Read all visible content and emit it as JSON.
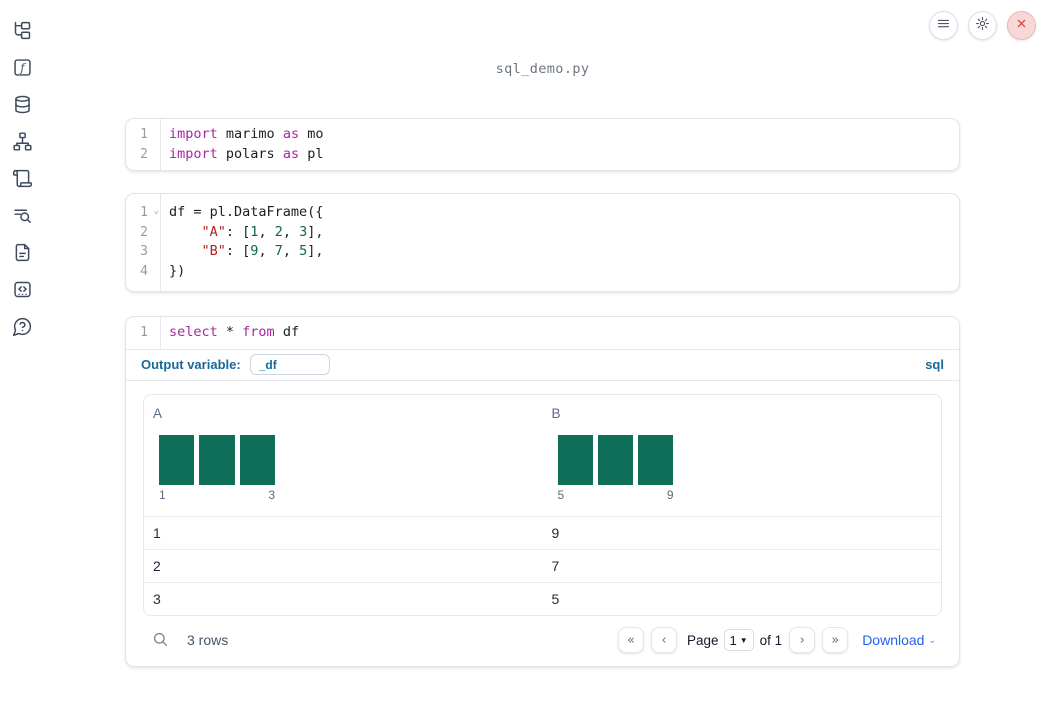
{
  "window": {
    "title": "sql_demo.py"
  },
  "sidebar": {
    "icons": [
      "file-explorer",
      "variables",
      "data-sources",
      "dependencies",
      "logs",
      "search-logs",
      "documentation",
      "snippets",
      "help"
    ]
  },
  "topbar": {
    "menu_icon": "hamburger-menu",
    "settings_icon": "gear",
    "close_icon": "x"
  },
  "cells": [
    {
      "lines": [
        {
          "num": "1",
          "tokens": [
            [
              "kw",
              "import"
            ],
            [
              "pl",
              " marimo "
            ],
            [
              "kw",
              "as"
            ],
            [
              "pl",
              " mo"
            ]
          ]
        },
        {
          "num": "2",
          "tokens": [
            [
              "kw",
              "import"
            ],
            [
              "pl",
              " polars "
            ],
            [
              "kw",
              "as"
            ],
            [
              "pl",
              " pl"
            ]
          ]
        }
      ]
    },
    {
      "lines": [
        {
          "num": "1",
          "fold": "⌄",
          "tokens": [
            [
              "pl",
              "df = pl.DataFrame({"
            ]
          ]
        },
        {
          "num": "2",
          "tokens": [
            [
              "pl",
              "    "
            ],
            [
              "str",
              "\"A\""
            ],
            [
              "pl",
              ": ["
            ],
            [
              "no",
              "1"
            ],
            [
              "pl",
              ", "
            ],
            [
              "no",
              "2"
            ],
            [
              "pl",
              ", "
            ],
            [
              "no",
              "3"
            ],
            [
              "pl",
              "],"
            ]
          ]
        },
        {
          "num": "3",
          "tokens": [
            [
              "pl",
              "    "
            ],
            [
              "str",
              "\"B\""
            ],
            [
              "pl",
              ": ["
            ],
            [
              "no",
              "9"
            ],
            [
              "pl",
              ", "
            ],
            [
              "no",
              "7"
            ],
            [
              "pl",
              ", "
            ],
            [
              "no",
              "5"
            ],
            [
              "pl",
              "],"
            ]
          ]
        },
        {
          "num": "4",
          "tokens": [
            [
              "pl",
              "})"
            ]
          ]
        }
      ]
    },
    {
      "lines": [
        {
          "num": "1",
          "tokens": [
            [
              "kw",
              "select"
            ],
            [
              "pl",
              " * "
            ],
            [
              "kw",
              "from"
            ],
            [
              "pl",
              " df"
            ]
          ]
        }
      ]
    }
  ],
  "sql_footer": {
    "output_variable_label": "Output variable:",
    "output_variable_value": "_df",
    "language_badge": "sql"
  },
  "table": {
    "columns": [
      {
        "name": "A",
        "histogram": {
          "values": [
            1,
            1,
            1
          ],
          "min_label": "1",
          "max_label": "3"
        }
      },
      {
        "name": "B",
        "histogram": {
          "values": [
            1,
            1,
            1
          ],
          "min_label": "5",
          "max_label": "9"
        }
      }
    ],
    "rows": [
      [
        "1",
        "9"
      ],
      [
        "2",
        "7"
      ],
      [
        "3",
        "5"
      ]
    ],
    "footer": {
      "row_count": "3 rows",
      "page_label": "Page",
      "page_value": "1",
      "of_label": "of 1",
      "download_label": "Download",
      "pager_icons": {
        "first": "«",
        "prev": "‹",
        "next": "›",
        "last": "»"
      }
    }
  },
  "colors": {
    "accent_blue": "#17689b",
    "link_blue": "#2563eb",
    "histogram_teal": "#0e6e58",
    "keyword": "#a626a4",
    "string": "#b02020",
    "number": "#116644"
  }
}
